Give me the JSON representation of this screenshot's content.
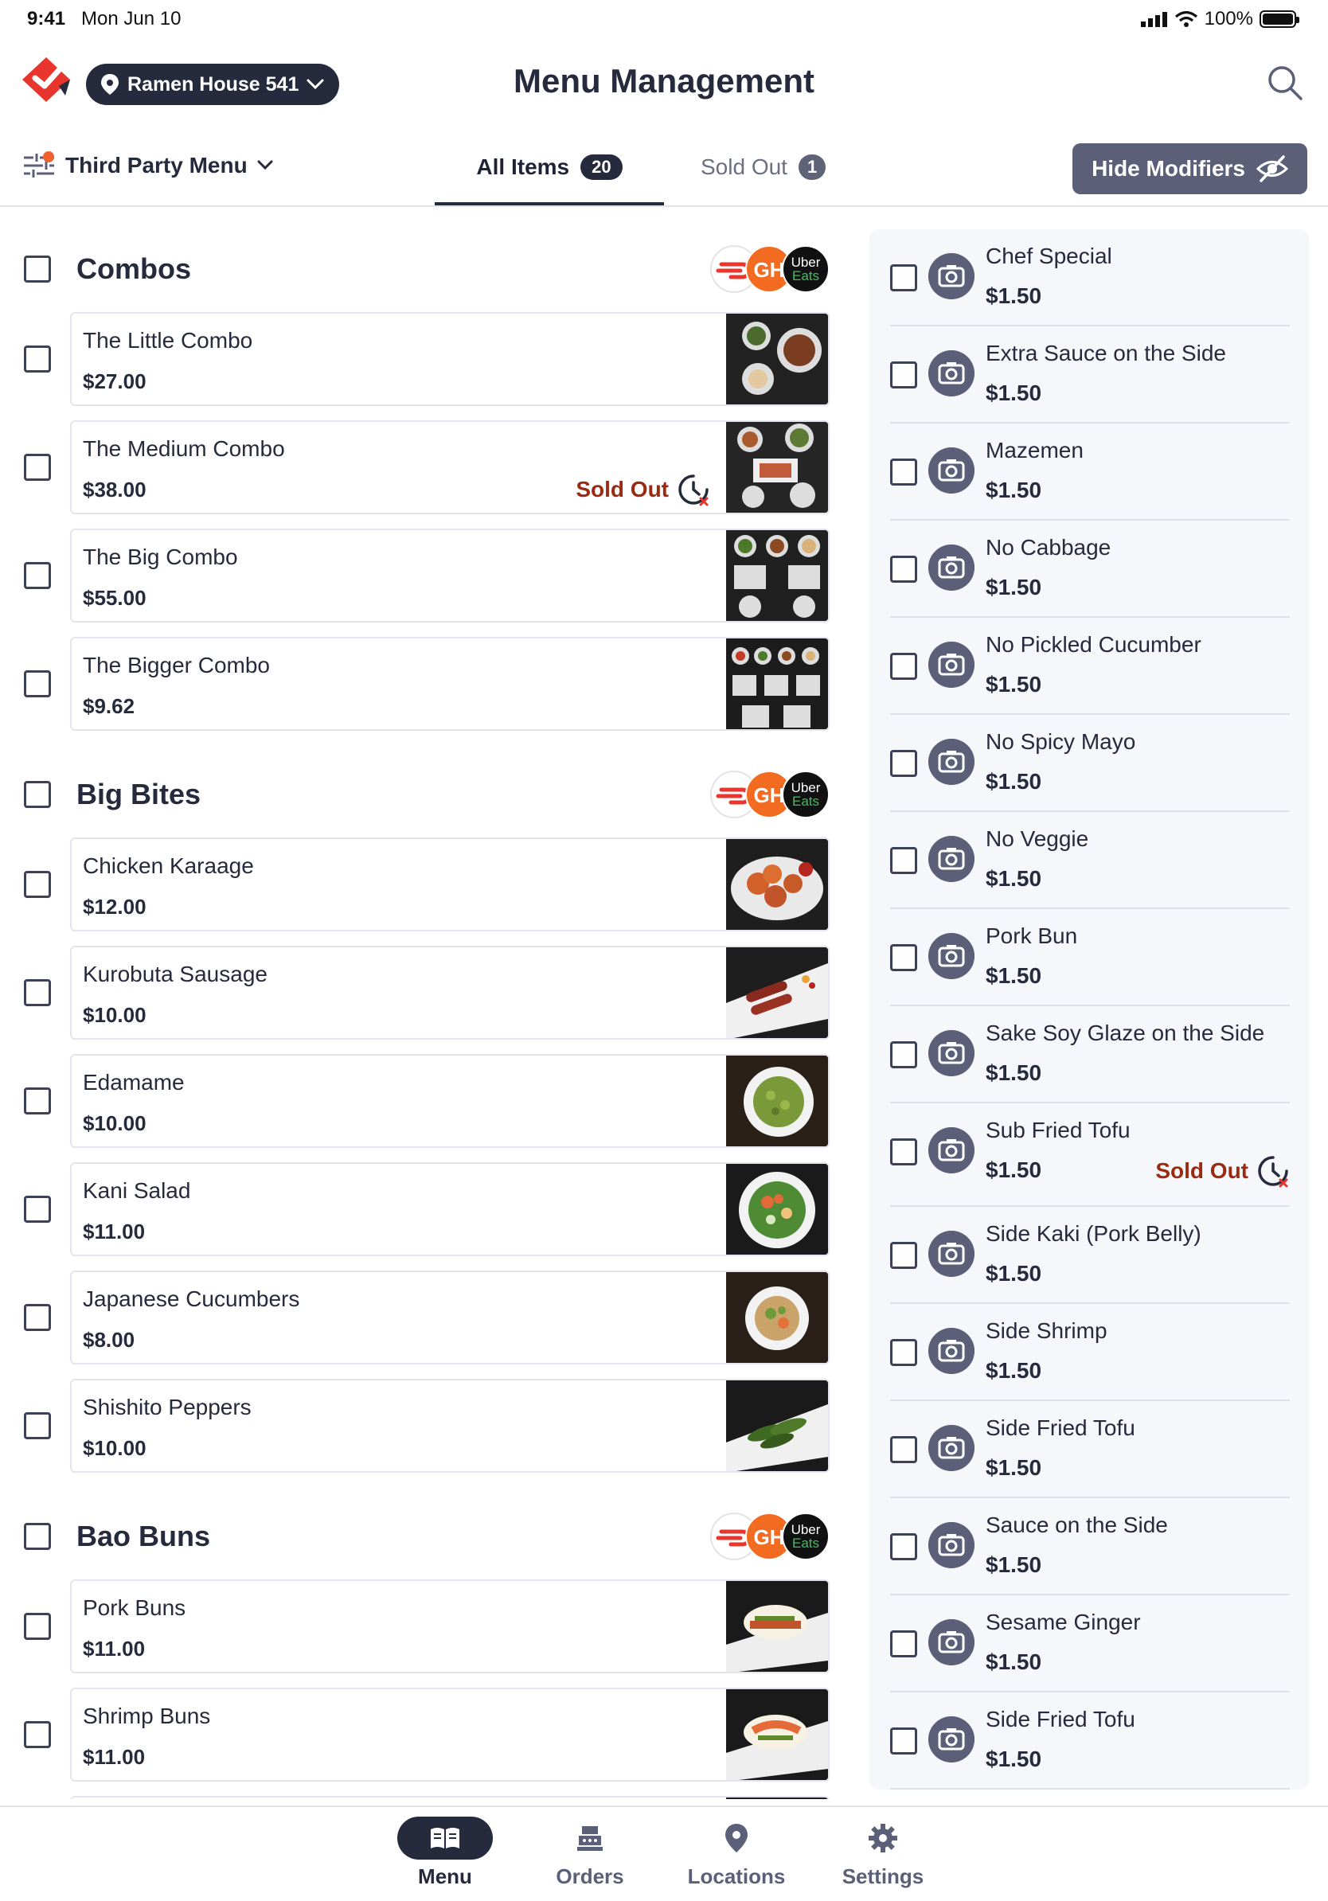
{
  "status_bar": {
    "time": "9:41",
    "date": "Mon Jun 10",
    "battery": "100%"
  },
  "header": {
    "location": "Ramen House 541",
    "title": "Menu Management"
  },
  "toolbar": {
    "menu_selector": "Third Party Menu",
    "tabs": [
      {
        "label": "All Items",
        "count": "20"
      },
      {
        "label": "Sold Out",
        "count": "1"
      }
    ],
    "hide_modifiers": "Hide Modifiers"
  },
  "platforms": {
    "ubereats_line1": "Uber",
    "ubereats_line2": "Eats",
    "grubhub": "GH"
  },
  "categories": [
    {
      "title": "Combos",
      "items": [
        {
          "name": "The Little Combo",
          "price": "$27.00"
        },
        {
          "name": "The Medium Combo",
          "price": "$38.00",
          "sold_out": "Sold Out"
        },
        {
          "name": "The Big Combo",
          "price": "$55.00"
        },
        {
          "name": "The Bigger Combo",
          "price": "$9.62"
        }
      ]
    },
    {
      "title": "Big Bites",
      "items": [
        {
          "name": "Chicken Karaage",
          "price": "$12.00"
        },
        {
          "name": "Kurobuta Sausage",
          "price": "$10.00"
        },
        {
          "name": "Edamame",
          "price": "$10.00"
        },
        {
          "name": "Kani Salad",
          "price": "$11.00"
        },
        {
          "name": "Japanese Cucumbers",
          "price": "$8.00"
        },
        {
          "name": "Shishito Peppers",
          "price": "$10.00"
        }
      ]
    },
    {
      "title": "Bao Buns",
      "items": [
        {
          "name": "Pork Buns",
          "price": "$11.00"
        },
        {
          "name": "Shrimp Buns",
          "price": "$11.00"
        }
      ]
    }
  ],
  "modifiers": [
    {
      "name": "Chef Special",
      "price": "$1.50"
    },
    {
      "name": "Extra Sauce on the Side",
      "price": "$1.50"
    },
    {
      "name": "Mazemen",
      "price": "$1.50"
    },
    {
      "name": "No Cabbage",
      "price": "$1.50"
    },
    {
      "name": "No Pickled Cucumber",
      "price": "$1.50"
    },
    {
      "name": "No Spicy Mayo",
      "price": "$1.50"
    },
    {
      "name": "No Veggie",
      "price": "$1.50"
    },
    {
      "name": "Pork Bun",
      "price": "$1.50"
    },
    {
      "name": "Sake Soy Glaze on the Side",
      "price": "$1.50"
    },
    {
      "name": "Sub Fried Tofu",
      "price": "$1.50",
      "sold_out": "Sold Out"
    },
    {
      "name": "Side Kaki (Pork Belly)",
      "price": "$1.50"
    },
    {
      "name": "Side Shrimp",
      "price": "$1.50"
    },
    {
      "name": "Side Fried Tofu",
      "price": "$1.50"
    },
    {
      "name": "Sauce on the Side",
      "price": "$1.50"
    },
    {
      "name": "Sesame Ginger",
      "price": "$1.50"
    },
    {
      "name": "Side Fried Tofu",
      "price": "$1.50"
    }
  ],
  "bottom_nav": [
    {
      "label": "Menu",
      "icon": "book-icon",
      "active": true
    },
    {
      "label": "Orders",
      "icon": "register-icon"
    },
    {
      "label": "Locations",
      "icon": "pin-icon"
    },
    {
      "label": "Settings",
      "icon": "gear-icon"
    }
  ],
  "colors": {
    "primary": "#262a3d",
    "secondary": "#5b6078",
    "sold_out": "#9a2b12",
    "accent": "#f0612e"
  }
}
